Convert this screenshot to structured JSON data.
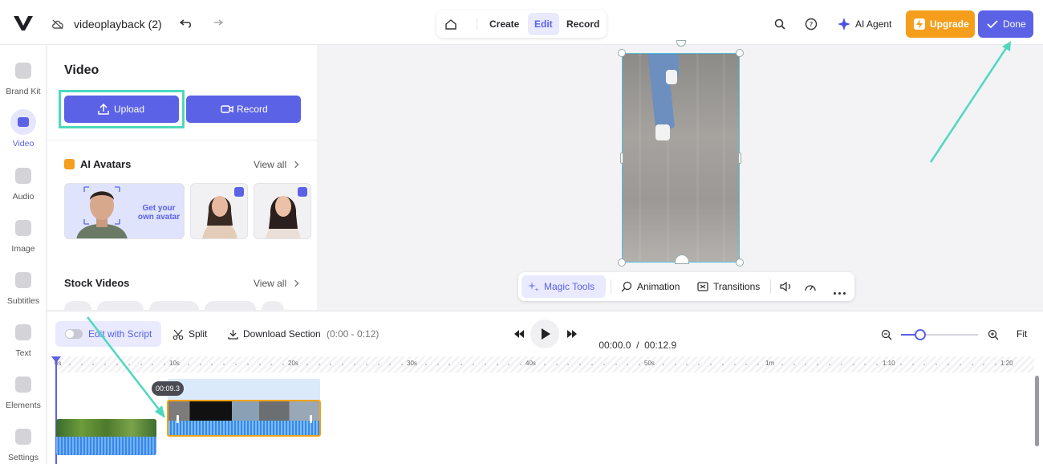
{
  "header": {
    "project_title": "videoplayback (2)",
    "modes": {
      "create": "Create",
      "edit": "Edit",
      "record": "Record"
    },
    "ai_agent": "AI Agent",
    "upgrade": "Upgrade",
    "done": "Done"
  },
  "rail": {
    "items": [
      {
        "label": "Brand Kit",
        "icon": "brand-kit-icon"
      },
      {
        "label": "Video",
        "icon": "video-icon",
        "active": true
      },
      {
        "label": "Audio",
        "icon": "music-icon"
      },
      {
        "label": "Image",
        "icon": "image-icon"
      },
      {
        "label": "Subtitles",
        "icon": "subtitles-icon"
      },
      {
        "label": "Text",
        "icon": "text-icon"
      },
      {
        "label": "Elements",
        "icon": "elements-icon"
      },
      {
        "label": "Settings",
        "icon": "settings-icon"
      }
    ]
  },
  "panel": {
    "title": "Video",
    "upload": "Upload",
    "record": "Record",
    "ai_avatars": {
      "title": "AI Avatars",
      "view_all": "View all",
      "get_your": "Get your own avatar"
    },
    "stock_videos": {
      "title": "Stock Videos",
      "view_all": "View all"
    }
  },
  "canvas_toolbar": {
    "magic_tools": "Magic Tools",
    "animation": "Animation",
    "transitions": "Transitions"
  },
  "timeline": {
    "edit_with_script": "Edit with Script",
    "split": "Split",
    "download_section": "Download Section",
    "download_range": "(0:00 - 0:12)",
    "current_time": "00:00.0",
    "separator": "/",
    "total_time": "00:12.9",
    "fit": "Fit",
    "zoom_level": 0.25,
    "tooltip_time": "00:09.3",
    "ruler": [
      "0s",
      "10s",
      "20s",
      "30s",
      "40s",
      "50s",
      "1m",
      "1:10",
      "1:20"
    ]
  },
  "colors": {
    "accent": "#5b62e6",
    "upgrade": "#f59e1b",
    "highlight": "#4fd8be",
    "clip_border": "#f2a418"
  }
}
